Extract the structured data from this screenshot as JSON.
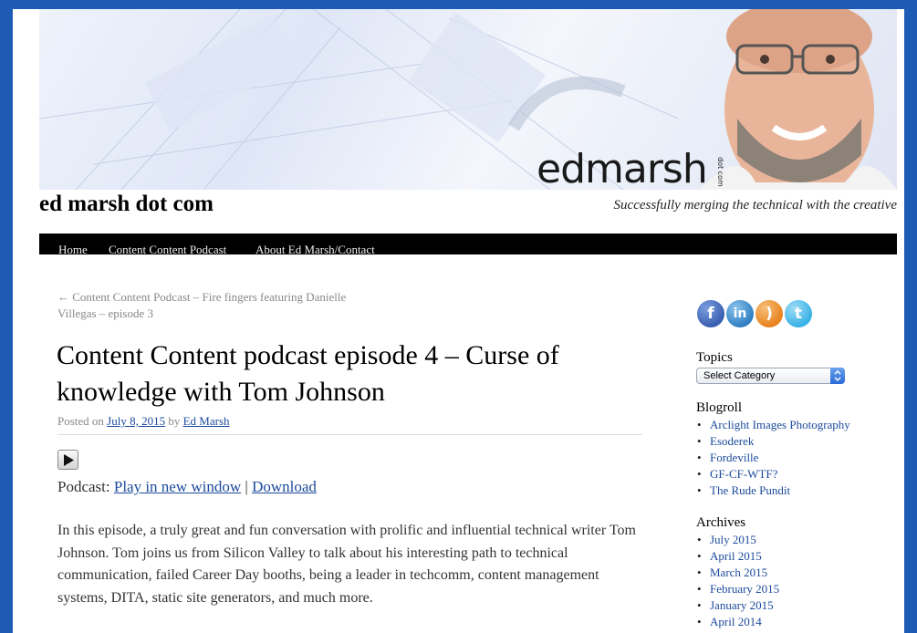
{
  "header": {
    "logo_text": "edmarsh",
    "logo_small": "dot com",
    "site_title": "ed marsh dot com",
    "tagline": "Successfully merging the technical with the creative"
  },
  "nav": {
    "items": [
      {
        "label": "Home"
      },
      {
        "label": "Content Content Podcast"
      },
      {
        "label": "About Ed Marsh/Contact"
      }
    ]
  },
  "post": {
    "prev_link": "← Content Content Podcast – Fire fingers featuring Danielle Villegas – episode 3",
    "title": "Content Content podcast episode 4 – Curse of knowledge with Tom Johnson",
    "meta": {
      "posted_on": "Posted on",
      "date": "July 8, 2015",
      "by": "by",
      "author": "Ed Marsh"
    },
    "podcast": {
      "label": "Podcast:",
      "play_link": "Play in new window",
      "separator": "|",
      "download_link": "Download"
    },
    "intro": "In this episode, a truly great and fun conversation with prolific and influential technical writer Tom Johnson. Tom joins us from Silicon Valley to talk about his interesting path to technical communication, failed Career Day booths, being a leader in techcomm, content management systems, DITA, static site generators, and much more."
  },
  "sidebar": {
    "social": [
      {
        "name": "facebook-icon",
        "glyph": "f",
        "color": "#3b5fb0"
      },
      {
        "name": "linkedin-icon",
        "glyph": "in",
        "color": "#2f7fc1"
      },
      {
        "name": "rss-icon",
        "glyph": ")",
        "color": "#e8821e"
      },
      {
        "name": "twitter-icon",
        "glyph": "t",
        "color": "#39b2e6"
      }
    ],
    "topics_heading": "Topics",
    "topics_select": "Select Category",
    "blogroll_heading": "Blogroll",
    "blogroll": [
      "Arclight Images Photography",
      "Esoderek",
      "Fordeville",
      "GF-CF-WTF?",
      "The Rude Pundit"
    ],
    "archives_heading": "Archives",
    "archives": [
      "July 2015",
      "April 2015",
      "March 2015",
      "February 2015",
      "January 2015",
      "April 2014"
    ]
  },
  "colors": {
    "link": "#1b4a9c",
    "window_border": "#1e5bb5",
    "navbar": "#000000"
  }
}
